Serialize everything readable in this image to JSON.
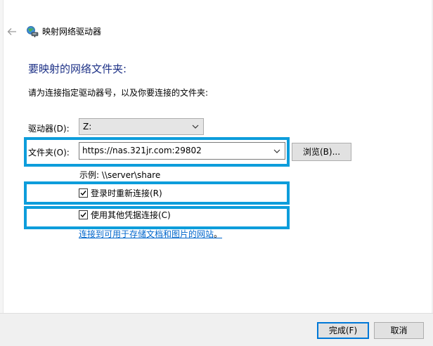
{
  "header": {
    "back_icon": "back-arrow-icon",
    "title_icon": "network-drive-icon",
    "title": "映射网络驱动器"
  },
  "main": {
    "heading": "要映射的网络文件夹:",
    "instruction": "请为连接指定驱动器号，以及你要连接的文件夹:",
    "drive": {
      "label": "驱动器(D):",
      "value": "Z:"
    },
    "folder": {
      "label": "文件夹(O):",
      "value": "https://nas.321jr.com:29802"
    },
    "browse_label": "浏览(B)...",
    "example": "示例: \\\\server\\share",
    "reconnect": {
      "label": "登录时重新连接(R)",
      "checked": true
    },
    "credentials": {
      "label": "使用其他凭据连接(C)",
      "checked": true
    },
    "storage_link": "连接到可用于存储文档和图片的网站",
    "storage_link_suffix": "。"
  },
  "footer": {
    "finish_label": "完成(F)",
    "cancel_label": "取消"
  },
  "colors": {
    "heading": "#1e3287",
    "link": "#0066cc",
    "highlight": "#0d9ddb",
    "primary_border": "#0078d7"
  }
}
